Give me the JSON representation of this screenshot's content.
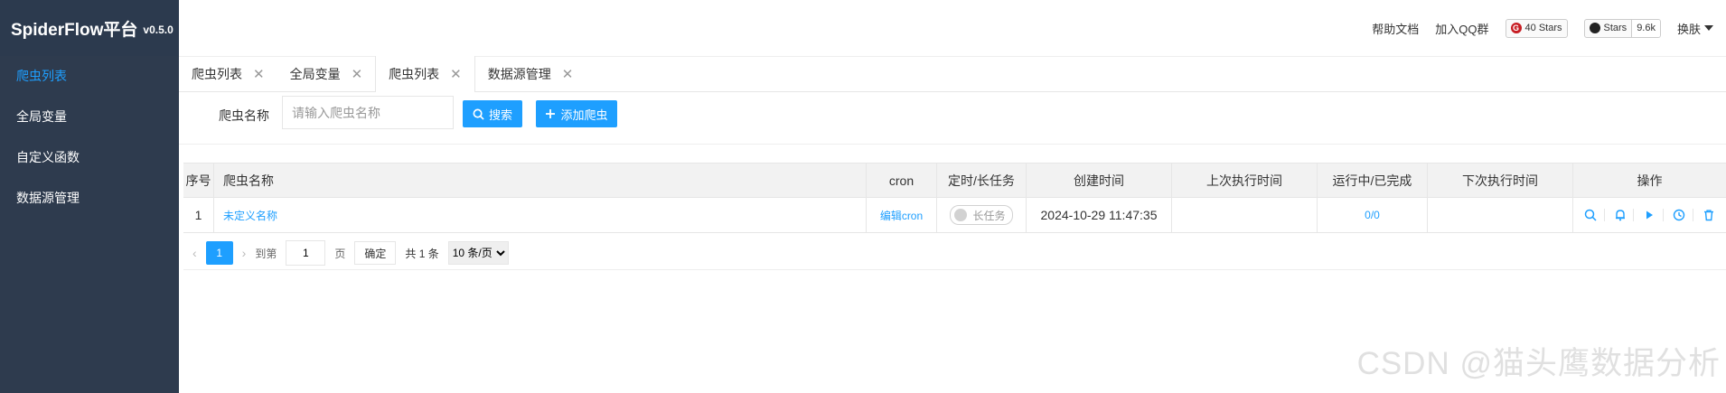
{
  "app": {
    "name": "SpiderFlow平台",
    "version": "v0.5.0"
  },
  "sidebar": {
    "items": [
      {
        "label": "爬虫列表",
        "active": true
      },
      {
        "label": "全局变量",
        "active": false
      },
      {
        "label": "自定义函数",
        "active": false
      },
      {
        "label": "数据源管理",
        "active": false
      }
    ]
  },
  "header": {
    "help": "帮助文档",
    "qq": "加入QQ群",
    "gitee_badge": {
      "icon": "gitee-logo-icon",
      "text": "40 Stars"
    },
    "github_badge": {
      "icon": "github-logo-icon",
      "label": "Stars",
      "count": "9.6k"
    },
    "skin": "换肤"
  },
  "tabs": [
    {
      "label": "爬虫列表",
      "active": false
    },
    {
      "label": "全局变量",
      "active": false
    },
    {
      "label": "爬虫列表",
      "active": true
    },
    {
      "label": "数据源管理",
      "active": false
    }
  ],
  "search": {
    "label": "爬虫名称",
    "placeholder": "请输入爬虫名称",
    "search_button": "搜索",
    "add_button": "添加爬虫"
  },
  "table": {
    "columns": [
      "序号",
      "爬虫名称",
      "cron",
      "定时/长任务",
      "创建时间",
      "上次执行时间",
      "运行中/已完成",
      "下次执行时间",
      "操作"
    ],
    "rows": [
      {
        "index": "1",
        "name": "未定义名称",
        "cron": "编辑cron",
        "task": "长任务",
        "created": "2024-10-29 11:47:35",
        "last_run": "",
        "running": "0/0",
        "next_run": ""
      }
    ],
    "operations": [
      "search-icon",
      "bell-icon",
      "play-icon",
      "clock-icon",
      "trash-icon"
    ]
  },
  "pagination": {
    "current": "1",
    "goto_prefix": "到第",
    "goto_value": "1",
    "goto_suffix": "页",
    "confirm": "确定",
    "total": "共 1 条",
    "page_size": "10 条/页"
  },
  "watermark": "CSDN @猫头鹰数据分析",
  "colors": {
    "accent": "#1e9fff",
    "sidebar": "#2e3b4e"
  }
}
